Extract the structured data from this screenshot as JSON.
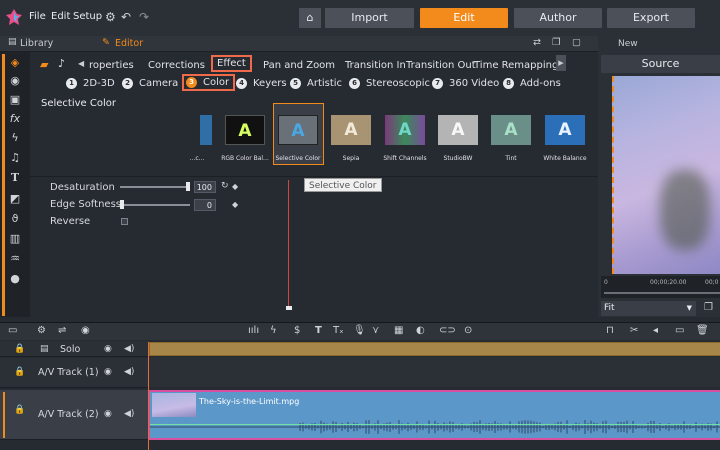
{
  "menu": {
    "file": "File",
    "edit": "Edit",
    "setup": "Setup"
  },
  "modes": [
    {
      "label": "Import",
      "active": false
    },
    {
      "label": "Edit",
      "active": true
    },
    {
      "label": "Author",
      "active": false
    },
    {
      "label": "Export",
      "active": false
    }
  ],
  "panel_tabs": {
    "library": "Library",
    "editor": "Editor"
  },
  "editor_tabs": [
    "roperties",
    "Corrections",
    "Effect",
    "Pan and Zoom",
    "Transition In",
    "Transition Out",
    "Time Remapping"
  ],
  "categories": [
    {
      "num": "1",
      "label": "2D-3D"
    },
    {
      "num": "2",
      "label": "Camera"
    },
    {
      "num": "3",
      "label": "Color"
    },
    {
      "num": "4",
      "label": "Keyers"
    },
    {
      "num": "5",
      "label": "Artistic"
    },
    {
      "num": "6",
      "label": "Stereoscopic"
    },
    {
      "num": "7",
      "label": "360 Video"
    },
    {
      "num": "8",
      "label": "Add-ons"
    }
  ],
  "selected_effect_title": "Selective Color",
  "effects": [
    {
      "label": "...c...",
      "letter": "",
      "bg": "#2f6fa6",
      "fg": "#fff"
    },
    {
      "label": "RGB Color Bal...",
      "letter": "A",
      "bg": "#111",
      "fg": "#d8ff60"
    },
    {
      "label": "Selective Color",
      "letter": "A",
      "bg": "#6a7078",
      "fg": "#49a7e3"
    },
    {
      "label": "Sepia",
      "letter": "A",
      "bg": "#a89472",
      "fg": "#f2ead8"
    },
    {
      "label": "Shift Channels",
      "letter": "A",
      "bg": "#7a4a82",
      "fg": "#6fd6c8"
    },
    {
      "label": "StudioBW",
      "letter": "A",
      "bg": "#b4b4b4",
      "fg": "#f8f8f8"
    },
    {
      "label": "Tint",
      "letter": "A",
      "bg": "#6a8f88",
      "fg": "#a9e0c8"
    },
    {
      "label": "White Balance",
      "letter": "A",
      "bg": "#2a6fb8",
      "fg": "#e8f3ff"
    }
  ],
  "tooltip": "Selective Color",
  "params": {
    "desaturation": {
      "label": "Desaturation",
      "value": "100",
      "level": 1.0
    },
    "edge_softness": {
      "label": "Edge Softness",
      "value": "0",
      "level": 0.0
    },
    "reverse": {
      "label": "Reverse",
      "checked": false
    }
  },
  "preview": {
    "title": "New Movie.Movie.AXP*",
    "source": "Source",
    "timecodes": [
      "0",
      "00;00;20.00",
      "00;0"
    ],
    "fit": "Fit"
  },
  "tracks": [
    {
      "name": "Solo"
    },
    {
      "name": "A/V Track (1)"
    },
    {
      "name": "A/V Track (2)"
    }
  ],
  "clip": {
    "name": "The-Sky-is-the-Limit.mpg"
  },
  "colors": {
    "accent": "#f28a1c",
    "highlight": "#ef6a4a",
    "clip": "#5b97c9",
    "solo": "#8a6a2a"
  }
}
